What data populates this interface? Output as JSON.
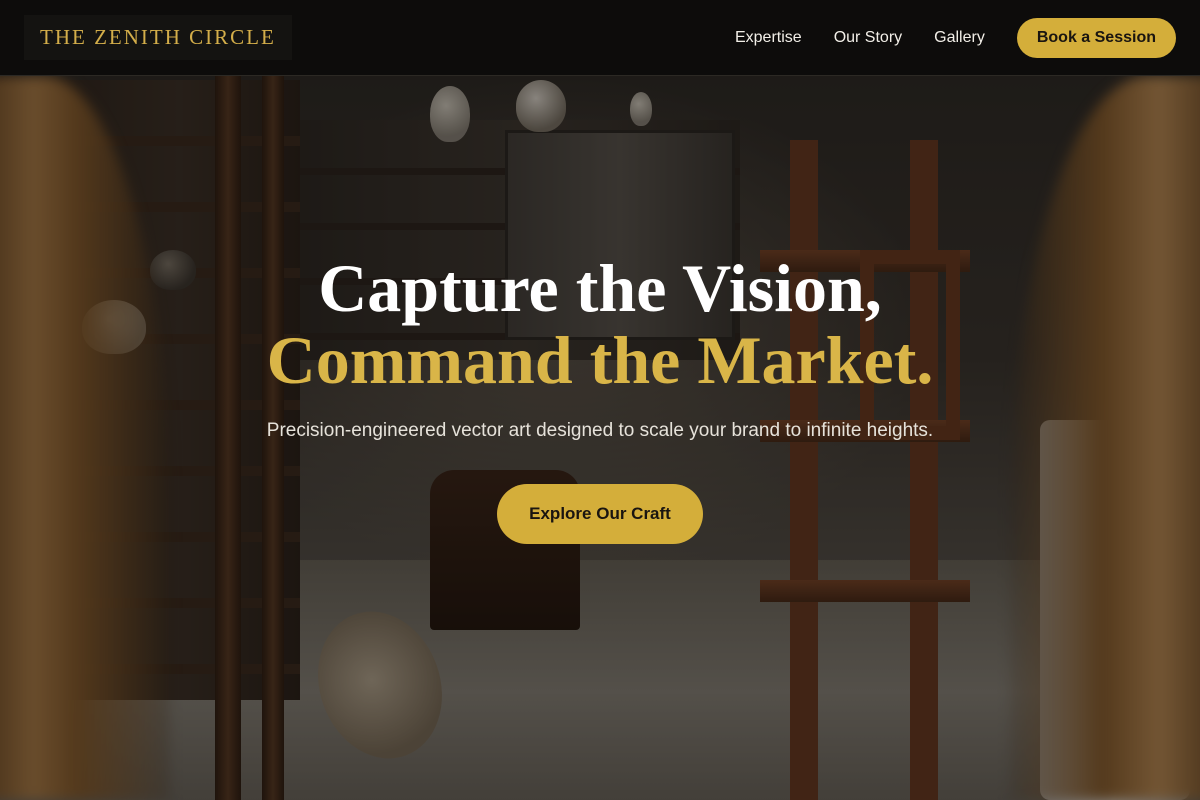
{
  "brand": {
    "name": "THE ZENITH CIRCLE"
  },
  "nav": {
    "items": [
      {
        "label": "Expertise"
      },
      {
        "label": "Our Story"
      },
      {
        "label": "Gallery"
      }
    ],
    "cta_label": "Book a Session"
  },
  "hero": {
    "headline_line1": "Capture the Vision,",
    "headline_line2": "Command the Market.",
    "subheadline": "Precision-engineered vector art designed to scale your brand to infinite heights.",
    "button_label": "Explore Our Craft"
  },
  "colors": {
    "accent_gold": "#d4ae3a",
    "header_bg": "#0d0c0b",
    "text_light": "#ffffff"
  },
  "background": {
    "icon": "art-studio-photo"
  }
}
